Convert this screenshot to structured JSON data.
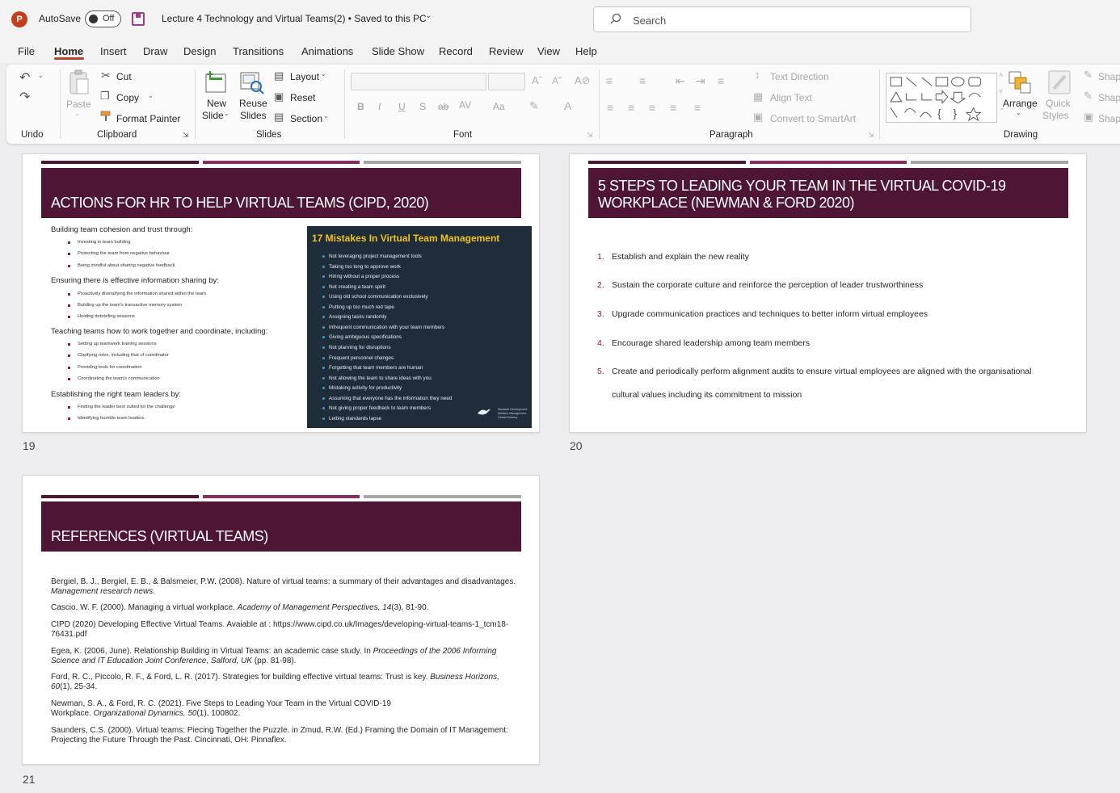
{
  "title_bar": {
    "app_logo": "P",
    "autosave_label": "AutoSave",
    "autosave_state": "Off",
    "doc_title": "Lecture 4 Technology and Virtual Teams(2)  •  Saved to this PC",
    "search_placeholder": "Search"
  },
  "tabs": [
    "File",
    "Home",
    "Insert",
    "Draw",
    "Design",
    "Transitions",
    "Animations",
    "Slide Show",
    "Record",
    "Review",
    "View",
    "Help"
  ],
  "active_tab": "Home",
  "ribbon": {
    "undo_group": "Undo",
    "clipboard": {
      "paste": "Paste",
      "cut": "Cut",
      "copy": "Copy",
      "format_painter": "Format Painter",
      "group": "Clipboard"
    },
    "slides": {
      "new_slide_1": "New",
      "new_slide_2": "Slide",
      "reuse_1": "Reuse",
      "reuse_2": "Slides",
      "layout": "Layout",
      "reset": "Reset",
      "section": "Section",
      "group": "Slides"
    },
    "font": {
      "group": "Font",
      "bold": "B",
      "italic": "I",
      "underline": "U",
      "shadow": "S",
      "strike": "ab",
      "spacing": "AV",
      "case": "Aa"
    },
    "paragraph": {
      "text_direction": "Text Direction",
      "align_text": "Align Text",
      "smartart": "Convert to SmartArt",
      "group": "Paragraph"
    },
    "drawing": {
      "arrange": "Arrange",
      "quick_1": "Quick",
      "quick_2": "Styles",
      "shape1": "Shap",
      "shape2": "Shap",
      "shape3": "Shap",
      "group": "Drawing"
    }
  },
  "slides": [
    {
      "number": "19",
      "title": "ACTIONS FOR HR TO HELP VIRTUAL TEAMS (CIPD, 2020)",
      "bullets": [
        {
          "text": "Building team cohesion and trust through:",
          "sub": [
            "Investing in team building",
            "Protecting the team from negative behaviour",
            "Being mindful about sharing negative feedback"
          ]
        },
        {
          "text": "Ensuring there is effective information sharing by:",
          "sub": [
            "Proactively diversifying the information shared within the team",
            "Building up the team's transactive memory system",
            "Holding debriefing sessions"
          ]
        },
        {
          "text": "Teaching teams how to work together and coordinate, including:",
          "sub": [
            "Setting up teamwork training sessions",
            "Clarifying roles, including that of coordinator",
            "Providing tools for coordination",
            "Coordinating the team's communication"
          ]
        },
        {
          "text": "Establishing the right team leaders by:",
          "sub": [
            "Finding the leader best suited for the challenge",
            "Identifying humble team leaders."
          ]
        }
      ],
      "image": {
        "title": "17 Mistakes In Virtual Team Management",
        "items": [
          "Not leveraging project management tools",
          "Taking too long to approve work",
          "Hiring without a proper process",
          "Not creating a team spirit",
          "Using old school communication exclusively",
          "Putting up too much red tape",
          "Assigning tasks randomly",
          "Infrequent communication with your team members",
          "Giving ambiguous specifications",
          "Not planning for disruptions",
          "Frequent personnel changes",
          "Forgetting that team members are human",
          "Not allowing the team to share ideas with you",
          "Mistaking activity for productivity",
          "Assuming that everyone has the information they need",
          "Not giving proper feedback to team members",
          "Letting standards lapse"
        ],
        "logo_text": [
          "Musician Development",
          "Western Management",
          "Global Delivery"
        ]
      }
    },
    {
      "number": "20",
      "title_line1": "5 STEPS TO LEADING YOUR TEAM IN THE VIRTUAL COVID-19",
      "title_line2": "WORKPLACE (NEWMAN & FORD 2020)",
      "steps": [
        "Establish and explain the new reality",
        "Sustain the corporate culture and reinforce the perception of leader trustworthiness",
        "Upgrade communication practices and techniques to better inform virtual employees",
        "Encourage shared leadership among team members",
        "Create and periodically perform alignment audits to ensure virtual employees are aligned with the organisational",
        "cultural values including its commitment to mission"
      ],
      "step_numbers": [
        "1.",
        "2.",
        "3.",
        "4.",
        "5."
      ]
    },
    {
      "number": "21",
      "title": "REFERENCES (VIRTUAL TEAMS)",
      "refs": [
        {
          "a": "Bergiel, B. J., Bergiel, E. B., & Balsmeier, P.W. (2008). Nature of virtual teams: a summary of their advantages and disadvantages. ",
          "b": "Management research news",
          "c": "."
        },
        {
          "a": "Cascio, W. F. (2000). Managing a virtual workplace. ",
          "b": "Academy of Management Perspectives, 14",
          "c": "(3), 81-90."
        },
        {
          "a": "CIPD (2020) Developing Effective Virtual Teams. Avaiable at : https://www.cipd.co.uk/Images/developing-virtual-teams-1_tcm18-76431.pdf",
          "b": "",
          "c": ""
        },
        {
          "a": "Egea, K. (2006, June). Relationship Building in Virtual Teams: an academic case study. In ",
          "b": "Proceedings of the 2006 Informing Science and IT Education Joint Conference, Salford, UK",
          "c": " (pp. 81-98)."
        },
        {
          "a": "Ford, R. C., Piccolo, R. F., & Ford, L. R. (2017). Strategies for building effective virtual teams: Trust is key. ",
          "b": "Business Horizons, 60",
          "c": "(1), 25-34."
        },
        {
          "a": "Newman, S. A., & Ford, R. C. (2021). Five Steps to Leading Your Team in the Virtual COVID-19 Workplace. ",
          "b": "Organizational Dynamics, 50",
          "c": "(1), 100802."
        },
        {
          "a": "Saunders, C.S. (2000). Virtual teams: Piecing Together the Puzzle. in Zmud, R.W. (Ed.) Framing the Domain of IT Management: Projecting the Future Through the Past. Cincinnati, OH: Pinnaflex.",
          "b": "",
          "c": ""
        }
      ]
    }
  ],
  "colors": {
    "header": "#4e1535",
    "bar1": "#4e1535",
    "bar2": "#8b2a63",
    "bar3": "#a6a6a6",
    "accent": "#b7472a"
  }
}
